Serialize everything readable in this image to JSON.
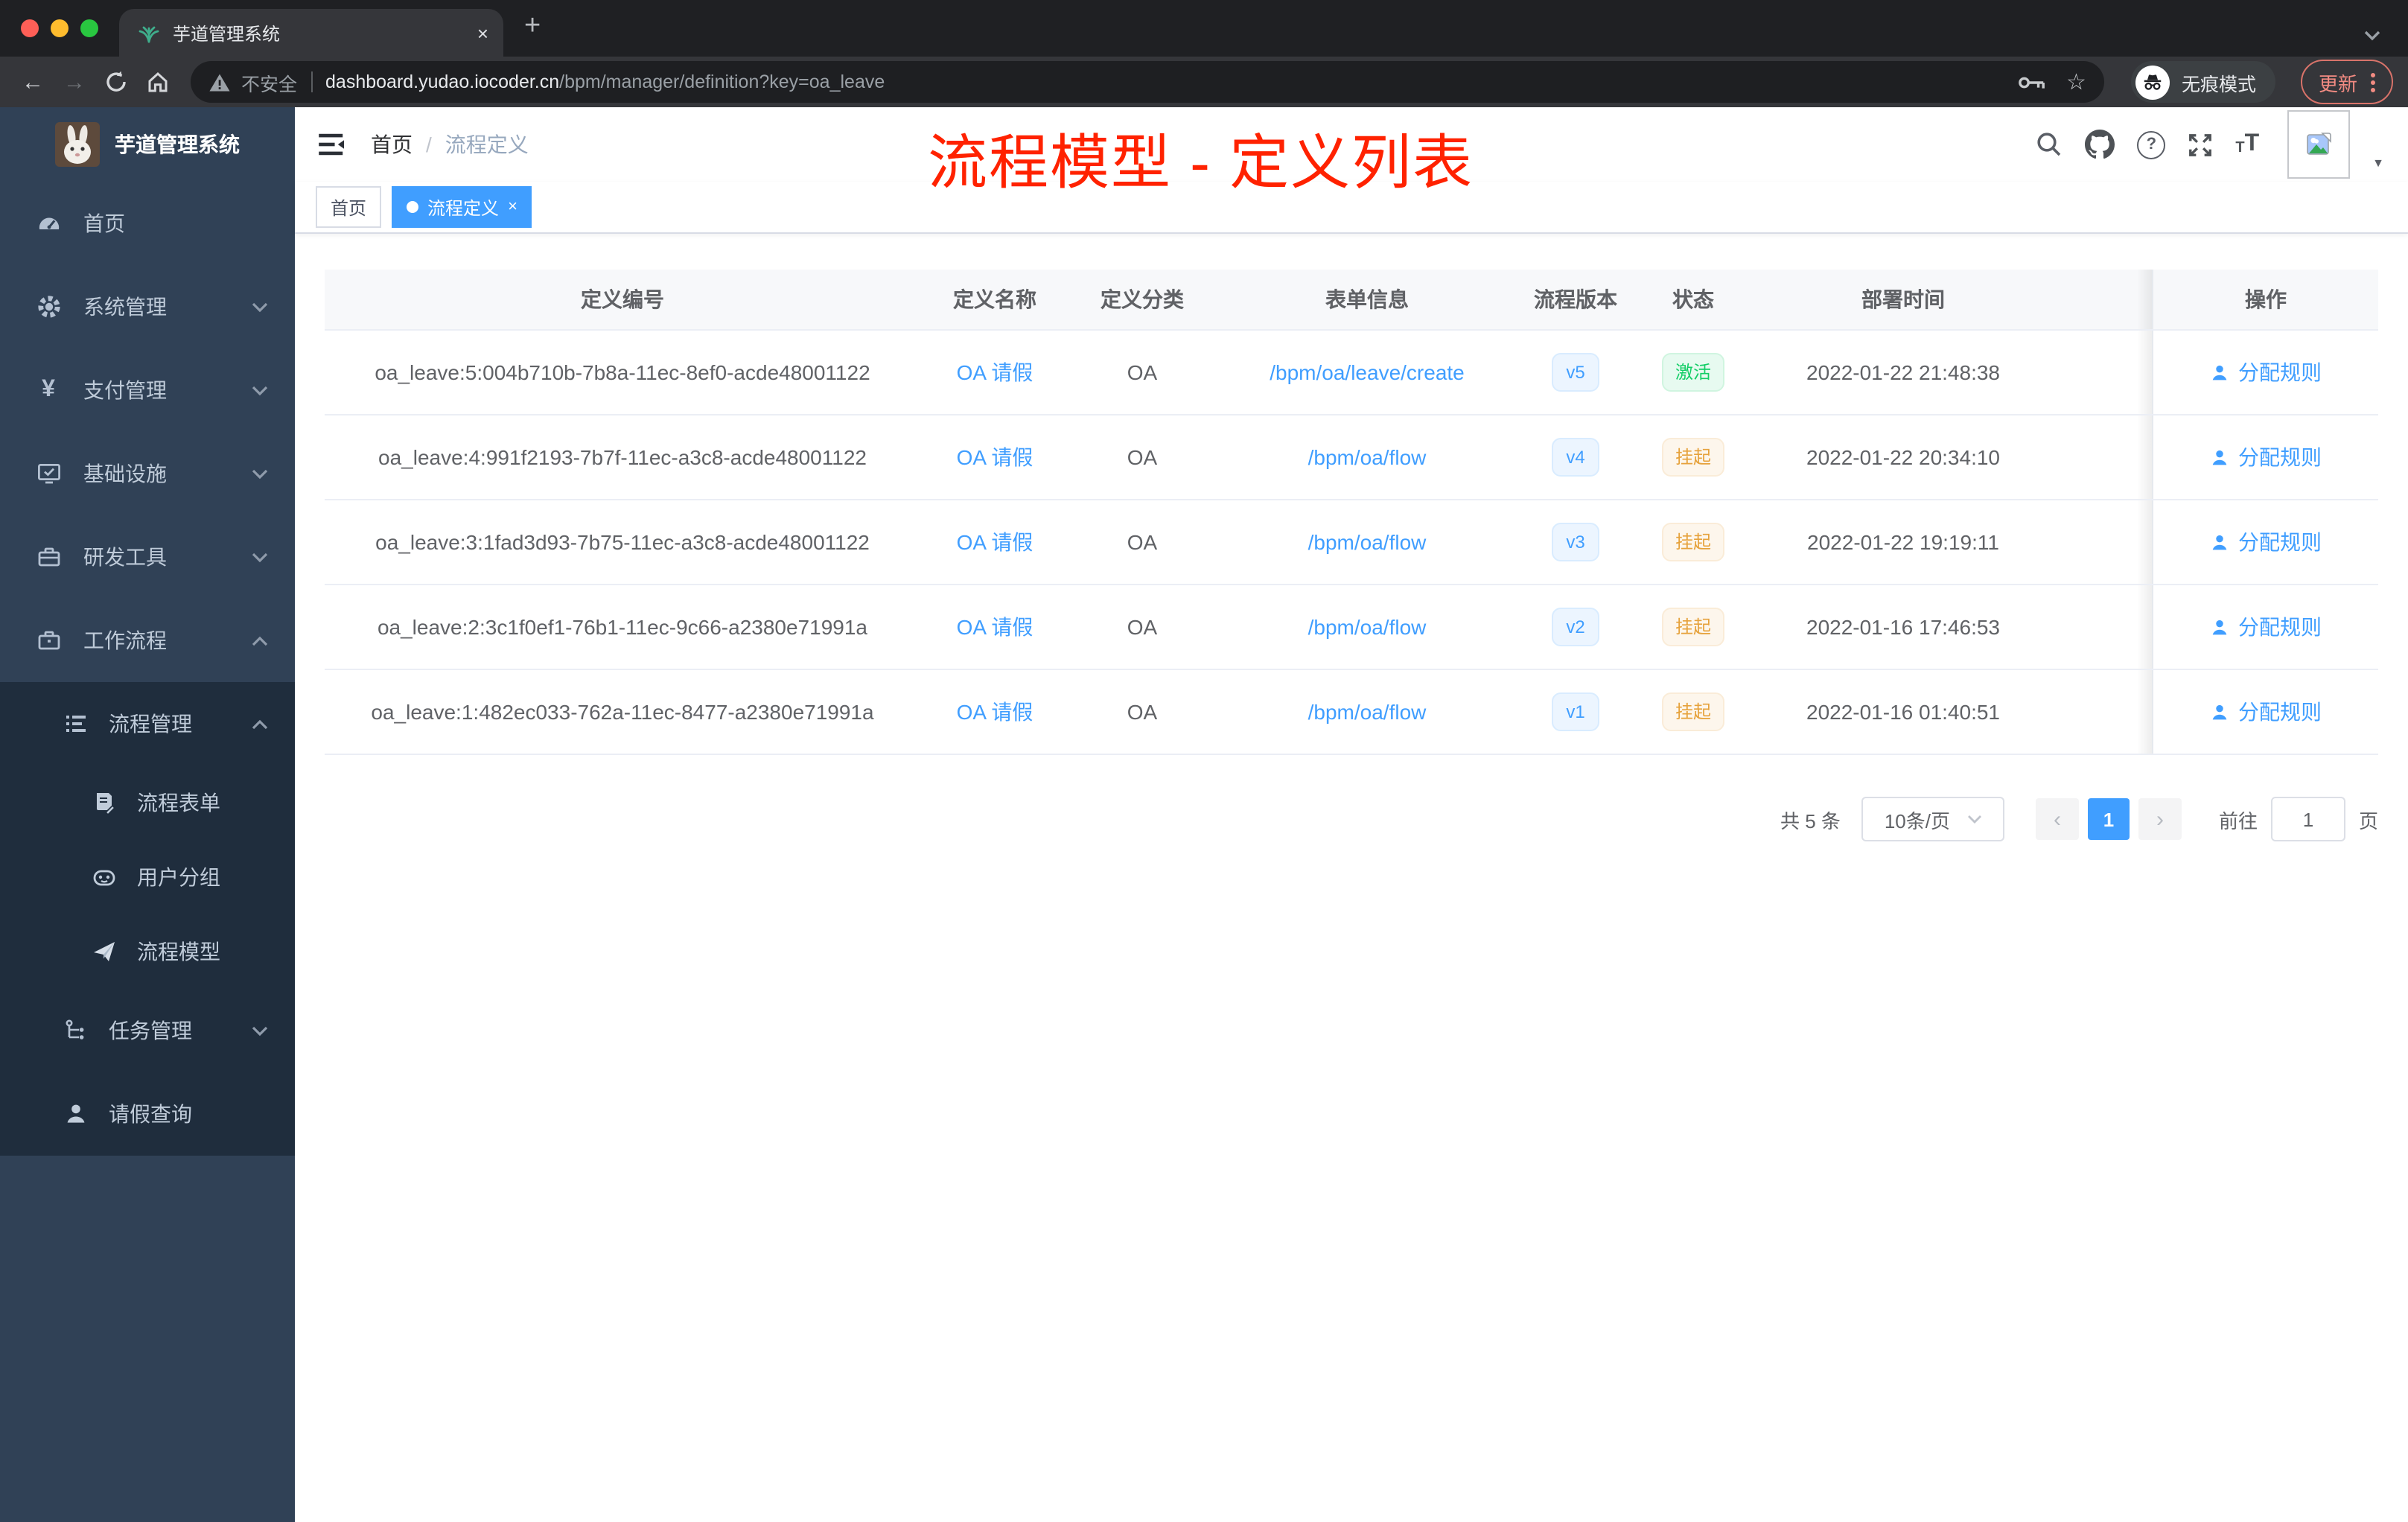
{
  "browser": {
    "tab_title": "芋道管理系统",
    "new_tab": "+",
    "close_tab": "×",
    "security_label": "不安全",
    "url_domain": "dashboard.yudao.iocoder.cn",
    "url_path": "/bpm/manager/definition?key=oa_leave",
    "incognito_label": "无痕模式",
    "update_label": "更新",
    "star": "☆",
    "back": "←",
    "forward": "→"
  },
  "sidebar": {
    "app_title": "芋道管理系统",
    "menu_top": [
      "首页",
      "系统管理",
      "支付管理",
      "基础设施",
      "研发工具",
      "工作流程"
    ],
    "menu_sub": [
      "流程管理",
      "流程表单",
      "用户分组",
      "流程模型",
      "任务管理",
      "请假查询"
    ]
  },
  "header": {
    "breadcrumb_home": "首页",
    "breadcrumb_sep": "/",
    "breadcrumb_current": "流程定义",
    "annotation": "流程模型 - 定义列表"
  },
  "tags": {
    "home": "首页",
    "active": "流程定义",
    "close": "×"
  },
  "table": {
    "columns": [
      "定义编号",
      "定义名称",
      "定义分类",
      "表单信息",
      "流程版本",
      "状态",
      "部署时间",
      "操作"
    ],
    "action_label": "分配规则",
    "rows": [
      {
        "id": "oa_leave:5:004b710b-7b8a-11ec-8ef0-acde48001122",
        "name": "OA 请假",
        "category": "OA",
        "form": "/bpm/oa/leave/create",
        "version": "v5",
        "status": "激活",
        "deployed": "2022-01-22 21:48:38"
      },
      {
        "id": "oa_leave:4:991f2193-7b7f-11ec-a3c8-acde48001122",
        "name": "OA 请假",
        "category": "OA",
        "form": "/bpm/oa/flow",
        "version": "v4",
        "status": "挂起",
        "deployed": "2022-01-22 20:34:10"
      },
      {
        "id": "oa_leave:3:1fad3d93-7b75-11ec-a3c8-acde48001122",
        "name": "OA 请假",
        "category": "OA",
        "form": "/bpm/oa/flow",
        "version": "v3",
        "status": "挂起",
        "deployed": "2022-01-22 19:19:11"
      },
      {
        "id": "oa_leave:2:3c1f0ef1-76b1-11ec-9c66-a2380e71991a",
        "name": "OA 请假",
        "category": "OA",
        "form": "/bpm/oa/flow",
        "version": "v2",
        "status": "挂起",
        "deployed": "2022-01-16 17:46:53"
      },
      {
        "id": "oa_leave:1:482ec033-762a-11ec-8477-a2380e71991a",
        "name": "OA 请假",
        "category": "OA",
        "form": "/bpm/oa/flow",
        "version": "v1",
        "status": "挂起",
        "deployed": "2022-01-16 01:40:51"
      }
    ]
  },
  "pagination": {
    "total": "共 5 条",
    "page_size": "10条/页",
    "prev": "‹",
    "page": "1",
    "next": "›",
    "goto_label": "前往",
    "jump_value": "1",
    "unit_label": "页"
  },
  "colors": {
    "accent": "#409eff",
    "success": "#13ce66",
    "warning": "#e6a23c",
    "annotation_red": "#ff2200",
    "sidebar_bg": "#304156",
    "submenu_bg": "#1f2d3d"
  }
}
